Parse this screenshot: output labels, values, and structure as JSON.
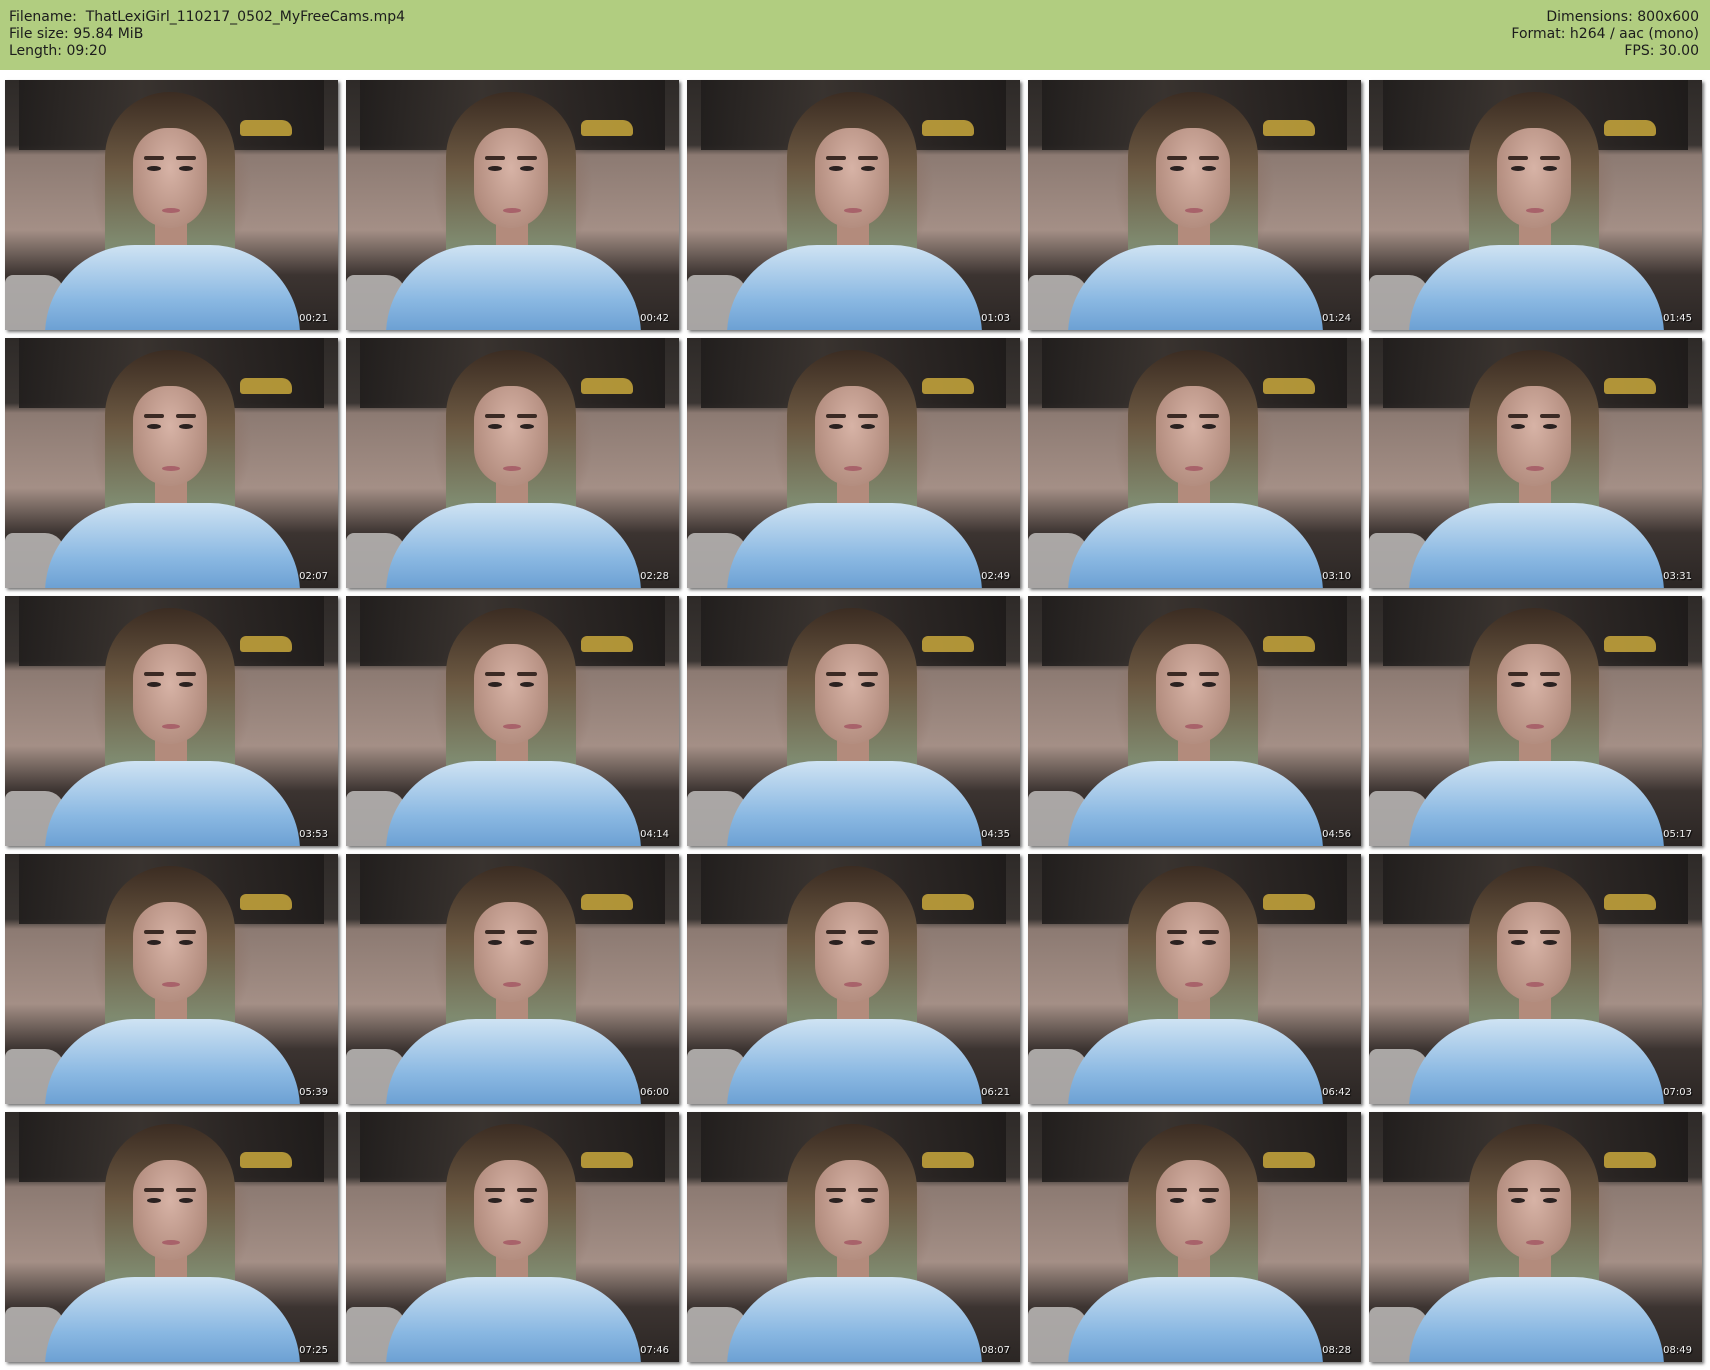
{
  "header": {
    "background_color": "#b1cd80",
    "left": [
      "Filename:  ThatLexiGirl_110217_0502_MyFreeCams.mp4",
      "File size: 95.84 MiB",
      "Length: 09:20"
    ],
    "right": [
      "Dimensions: 800x600",
      "Format: h264 / aac (mono)",
      "FPS: 30.00"
    ]
  },
  "thumbnails": [
    {
      "time": "00:21"
    },
    {
      "time": "00:42"
    },
    {
      "time": "01:03"
    },
    {
      "time": "01:24"
    },
    {
      "time": "01:45"
    },
    {
      "time": "02:07"
    },
    {
      "time": "02:28"
    },
    {
      "time": "02:49"
    },
    {
      "time": "03:10"
    },
    {
      "time": "03:31"
    },
    {
      "time": "03:53"
    },
    {
      "time": "04:14"
    },
    {
      "time": "04:35"
    },
    {
      "time": "04:56"
    },
    {
      "time": "05:17"
    },
    {
      "time": "05:39"
    },
    {
      "time": "06:00"
    },
    {
      "time": "06:21"
    },
    {
      "time": "06:42"
    },
    {
      "time": "07:03"
    },
    {
      "time": "07:25"
    },
    {
      "time": "07:46"
    },
    {
      "time": "08:07"
    },
    {
      "time": "08:28"
    },
    {
      "time": "08:49"
    }
  ]
}
